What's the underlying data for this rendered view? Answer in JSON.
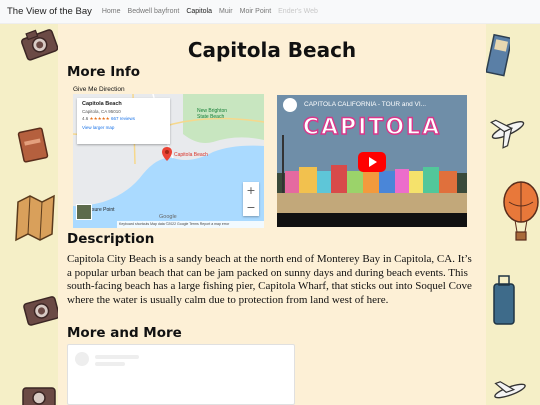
{
  "navbar": {
    "brand": "The View of the Bay",
    "links": [
      "Home",
      "Bedwell bayfront",
      "Capitola",
      "Muir",
      "Moir Point",
      "Ender's Web"
    ]
  },
  "page": {
    "title": "Capitola Beach",
    "more_info_heading": "More Info",
    "give_directions": "Give Me Direction",
    "description_heading": "Description",
    "description": "Capitola City Beach is a sandy beach at the north end of Monterey Bay in Capitola, CA. It’s a popular urban beach that can be jam packed on sunny days and during beach events. This south-facing beach has a large fishing pier, Capitola Wharf, that sticks out into Soquel Cove where the water is usually calm due to protection from land west of here.",
    "more_heading": "More and More"
  },
  "map": {
    "place_name": "Capitola Beach",
    "address": "Capitola, CA 95010",
    "rating": "4.6",
    "stars": "★★★★★",
    "reviews": "667 reviews",
    "larger_map": "View larger map",
    "pin_label": "Capitola Beach",
    "park_label": "New Brighton State Beach",
    "point_label": "sure Point",
    "zoom_in": "+",
    "zoom_out": "−",
    "footer": "Keyboard shortcuts   Map data ©2022 Google   Terms   Report a map error",
    "google": "Google"
  },
  "video": {
    "title": "CAPITOLA CALIFORNIA - TOUR and VI...",
    "overlay_text": "CAPITOLA"
  },
  "colors": {
    "background": "#f5efc7",
    "panel": "#fdf0d6",
    "youtube_red": "#ff0000",
    "video_text_stroke": "#d9378b"
  }
}
